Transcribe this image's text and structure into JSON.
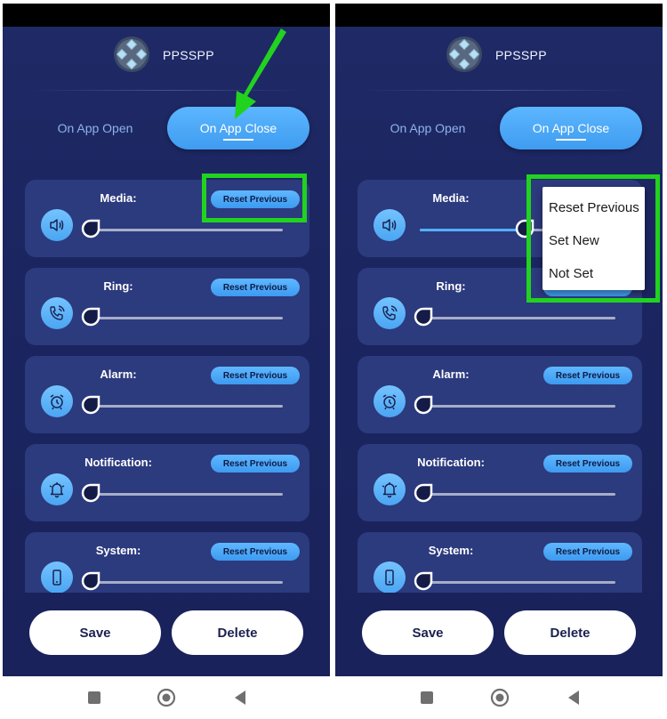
{
  "app": {
    "title": "PPSSPP"
  },
  "tabs": {
    "open_label": "On App Open",
    "close_label": "On App Close"
  },
  "cards": [
    {
      "label": "Media:",
      "button": "Reset Previous",
      "icon": "speaker-icon",
      "level_left": 0,
      "level_right": 0.52
    },
    {
      "label": "Ring:",
      "button": "Reset Previous",
      "icon": "phone-ring-icon",
      "level_left": 0,
      "level_right": 0
    },
    {
      "label": "Alarm:",
      "button": "Reset Previous",
      "icon": "alarm-clock-icon",
      "level_left": 0,
      "level_right": 0
    },
    {
      "label": "Notification:",
      "button": "Reset Previous",
      "icon": "bell-icon",
      "level_left": 0,
      "level_right": 0
    },
    {
      "label": "System:",
      "button": "Reset Previous",
      "icon": "smartphone-icon",
      "level_left": 0,
      "level_right": 0
    }
  ],
  "actions": {
    "save": "Save",
    "delete": "Delete"
  },
  "dropdown": {
    "options": [
      "Reset Previous",
      "Set New",
      "Not Set"
    ]
  },
  "colors": {
    "background": "#1c2660",
    "card": "#2c3a7e",
    "accent": "#4aa5f2",
    "highlight": "#21d21f"
  }
}
